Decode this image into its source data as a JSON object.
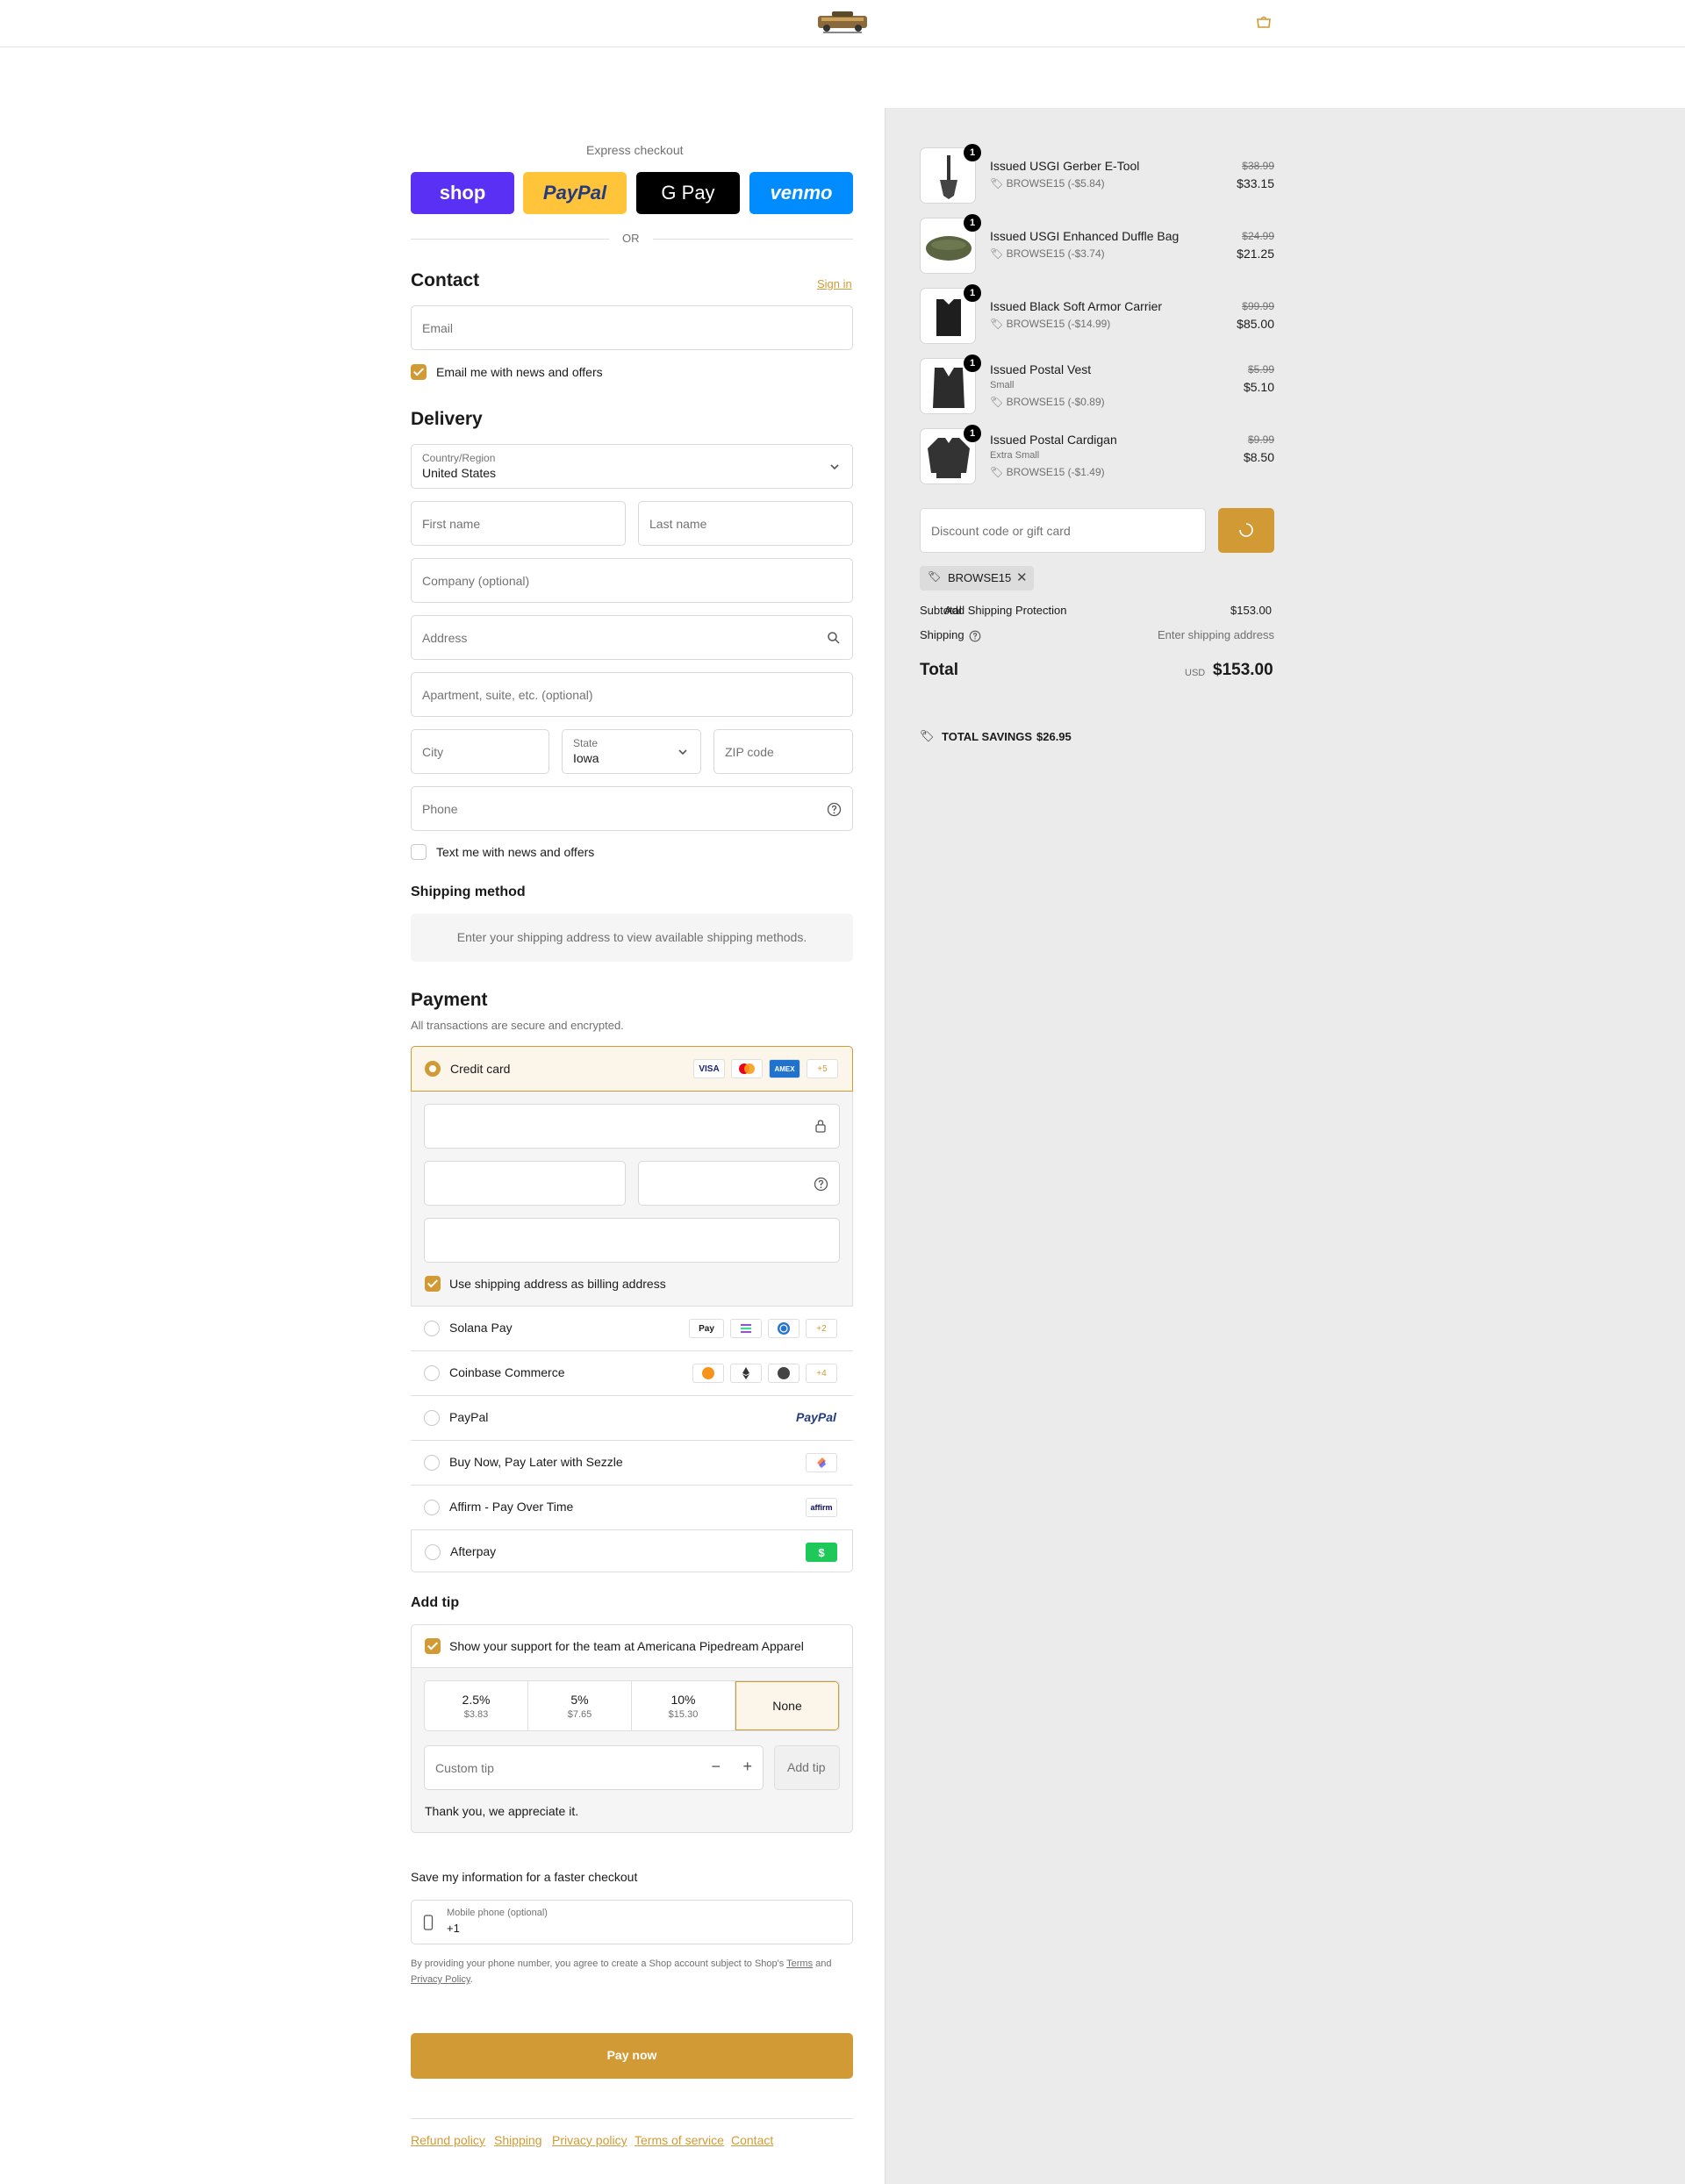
{
  "header": {
    "logo_name": "store-logo",
    "cart_icon": "shopping-bag-icon"
  },
  "express": {
    "title": "Express checkout",
    "buttons": [
      {
        "label": "shop",
        "color": "#5a31f4"
      },
      {
        "label": "PayPal",
        "color": "#ffc439"
      },
      {
        "label": "G Pay",
        "color": "#000000"
      },
      {
        "label": "venmo",
        "color": "#008cff"
      }
    ],
    "or": "OR"
  },
  "contact": {
    "title": "Contact",
    "sign_in": "Sign in",
    "email_placeholder": "Email",
    "news_label": "Email me with news and offers",
    "news_checked": true
  },
  "delivery": {
    "title": "Delivery",
    "country_label": "Country/Region",
    "country_value": "United States",
    "first_name": "First name",
    "last_name": "Last name",
    "company": "Company (optional)",
    "address": "Address",
    "apartment": "Apartment, suite, etc. (optional)",
    "city": "City",
    "state_label": "State",
    "state_value": "Iowa",
    "zip": "ZIP code",
    "phone": "Phone",
    "text_news": "Text me with news and offers"
  },
  "shipping_method": {
    "title": "Shipping method",
    "notice": "Enter your shipping address to view available shipping methods."
  },
  "payment": {
    "title": "Payment",
    "subtitle": "All transactions are secure and encrypted.",
    "credit_card": "Credit card",
    "card_badges": [
      "VISA",
      "MC",
      "AMEX",
      "+5"
    ],
    "billing_same": "Use shipping address as billing address",
    "methods": [
      {
        "label": "Solana Pay",
        "badges": [
          "Pay",
          "SOL",
          "USDC",
          "+2"
        ]
      },
      {
        "label": "Coinbase Commerce",
        "badges": [
          "BTC",
          "ETH",
          "LTC",
          "+4"
        ]
      },
      {
        "label": "PayPal",
        "badges": [
          "PayPal"
        ]
      },
      {
        "label": "Buy Now, Pay Later with Sezzle",
        "badges": [
          "S"
        ]
      },
      {
        "label": "Affirm - Pay Over Time",
        "badges": [
          "affirm"
        ]
      },
      {
        "label": "Afterpay",
        "badges": [
          "$"
        ]
      }
    ],
    "accent": "#d19a35"
  },
  "tip": {
    "title": "Add tip",
    "support_label": "Show your support for the team at Americana Pipedream Apparel",
    "options": [
      {
        "pct": "2.5%",
        "amount": "$3.83"
      },
      {
        "pct": "5%",
        "amount": "$7.65"
      },
      {
        "pct": "10%",
        "amount": "$15.30"
      },
      {
        "pct": "None",
        "amount": ""
      }
    ],
    "custom_placeholder": "Custom tip",
    "add_button": "Add tip",
    "thanks": "Thank you, we appreciate it."
  },
  "save_info": {
    "title": "Save my information for a faster checkout",
    "phone_label": "Mobile phone (optional)",
    "phone_value": "+1",
    "disclaimer_1": "By providing your phone number, you agree to create a Shop account subject to Shop's",
    "terms": "Terms",
    "and": "and",
    "privacy": "Privacy Policy",
    "dot": "."
  },
  "pay_now": "Pay now",
  "footer_links": [
    "Refund policy",
    "Shipping",
    "Privacy policy",
    "Terms of service",
    "Contact"
  ],
  "summary": {
    "items": [
      {
        "name": "Issued USGI Gerber E-Tool",
        "variant": "",
        "discount": "BROWSE15 (-$5.84)",
        "old_price": "$38.99",
        "price": "$33.15",
        "qty": "1",
        "icon": "shovel-icon"
      },
      {
        "name": "Issued USGI Enhanced Duffle Bag",
        "variant": "",
        "discount": "BROWSE15 (-$3.74)",
        "old_price": "$24.99",
        "price": "$21.25",
        "qty": "1",
        "icon": "duffle-bag-icon"
      },
      {
        "name": "Issued Black Soft Armor Carrier",
        "variant": "",
        "discount": "BROWSE15 (-$14.99)",
        "old_price": "$99.99",
        "price": "$85.00",
        "qty": "1",
        "icon": "armor-carrier-icon"
      },
      {
        "name": "Issued Postal Vest",
        "variant": "Small",
        "discount": "BROWSE15 (-$0.89)",
        "old_price": "$5.99",
        "price": "$5.10",
        "qty": "1",
        "icon": "vest-icon"
      },
      {
        "name": "Issued Postal Cardigan",
        "variant": "Extra Small",
        "discount": "BROWSE15 (-$1.49)",
        "old_price": "$9.99",
        "price": "$8.50",
        "qty": "1",
        "icon": "cardigan-icon"
      }
    ],
    "discount_placeholder": "Discount code or gift card",
    "applied_code": "BROWSE15",
    "subtotal_label": "Subtotal",
    "overlay_label": "Add Shipping Protection",
    "subtotal_value": "$153.00",
    "shipping_label": "Shipping",
    "shipping_value": "Enter shipping address",
    "total_label": "Total",
    "currency": "USD",
    "total_value": "$153.00",
    "savings_label": "TOTAL SAVINGS",
    "savings_value": "$26.95"
  }
}
